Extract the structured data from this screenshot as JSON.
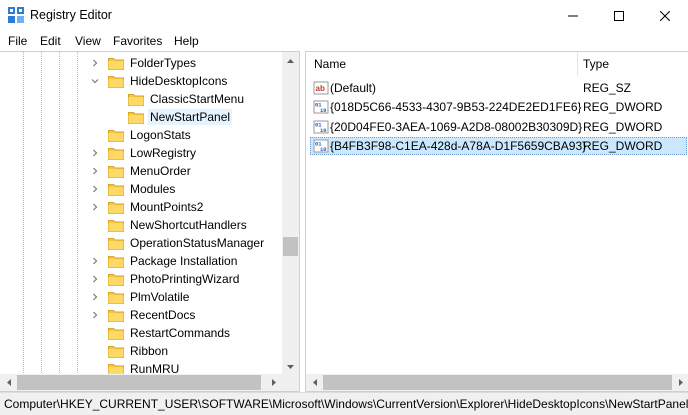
{
  "window": {
    "title": "Registry Editor",
    "icon": "registry-editor-icon",
    "controls": [
      "minimize-icon",
      "maximize-icon",
      "close-icon"
    ]
  },
  "menu": [
    "File",
    "Edit",
    "View",
    "Favorites",
    "Help"
  ],
  "tree": {
    "items": [
      {
        "label": "FolderTypes",
        "expander": "collapsed",
        "selected": false
      },
      {
        "label": "HideDesktopIcons",
        "expander": "expanded",
        "selected": false
      },
      {
        "label": "ClassicStartMenu",
        "expander": "none",
        "selected": false
      },
      {
        "label": "NewStartPanel",
        "expander": "none",
        "selected": true
      },
      {
        "label": "LogonStats",
        "expander": "none",
        "selected": false
      },
      {
        "label": "LowRegistry",
        "expander": "collapsed",
        "selected": false
      },
      {
        "label": "MenuOrder",
        "expander": "collapsed",
        "selected": false
      },
      {
        "label": "Modules",
        "expander": "collapsed",
        "selected": false
      },
      {
        "label": "MountPoints2",
        "expander": "collapsed",
        "selected": false
      },
      {
        "label": "NewShortcutHandlers",
        "expander": "none",
        "selected": false
      },
      {
        "label": "OperationStatusManager",
        "expander": "none",
        "selected": false
      },
      {
        "label": "Package Installation",
        "expander": "collapsed",
        "selected": false
      },
      {
        "label": "PhotoPrintingWizard",
        "expander": "collapsed",
        "selected": false
      },
      {
        "label": "PlmVolatile",
        "expander": "collapsed",
        "selected": false
      },
      {
        "label": "RecentDocs",
        "expander": "collapsed",
        "selected": false
      },
      {
        "label": "RestartCommands",
        "expander": "none",
        "selected": false
      },
      {
        "label": "Ribbon",
        "expander": "none",
        "selected": false
      },
      {
        "label": "RunMRU",
        "expander": "none",
        "selected": false
      }
    ]
  },
  "list": {
    "columns": {
      "name": "Name",
      "type": "Type"
    },
    "rows": [
      {
        "name": "(Default)",
        "type": "REG_SZ",
        "icon": "string-value-icon",
        "selected": false
      },
      {
        "name": "{018D5C66-4533-4307-9B53-224DE2ED1FE6}",
        "type": "REG_DWORD",
        "icon": "binary-value-icon",
        "selected": false
      },
      {
        "name": "{20D04FE0-3AEA-1069-A2D8-08002B30309D}",
        "type": "REG_DWORD",
        "icon": "binary-value-icon",
        "selected": false
      },
      {
        "name": "{B4FB3F98-C1EA-428d-A78A-D1F5659CBA93}",
        "type": "REG_DWORD",
        "icon": "binary-value-icon",
        "selected": true
      }
    ]
  },
  "status": {
    "path": "Computer\\HKEY_CURRENT_USER\\SOFTWARE\\Microsoft\\Windows\\CurrentVersion\\Explorer\\HideDesktopIcons\\NewStartPanel"
  },
  "colors": {
    "folder": "#f2c94c",
    "selection": "#cce8ff",
    "tree_selection": "#e5f3ff",
    "scrollbar": "#f0f0f0"
  }
}
